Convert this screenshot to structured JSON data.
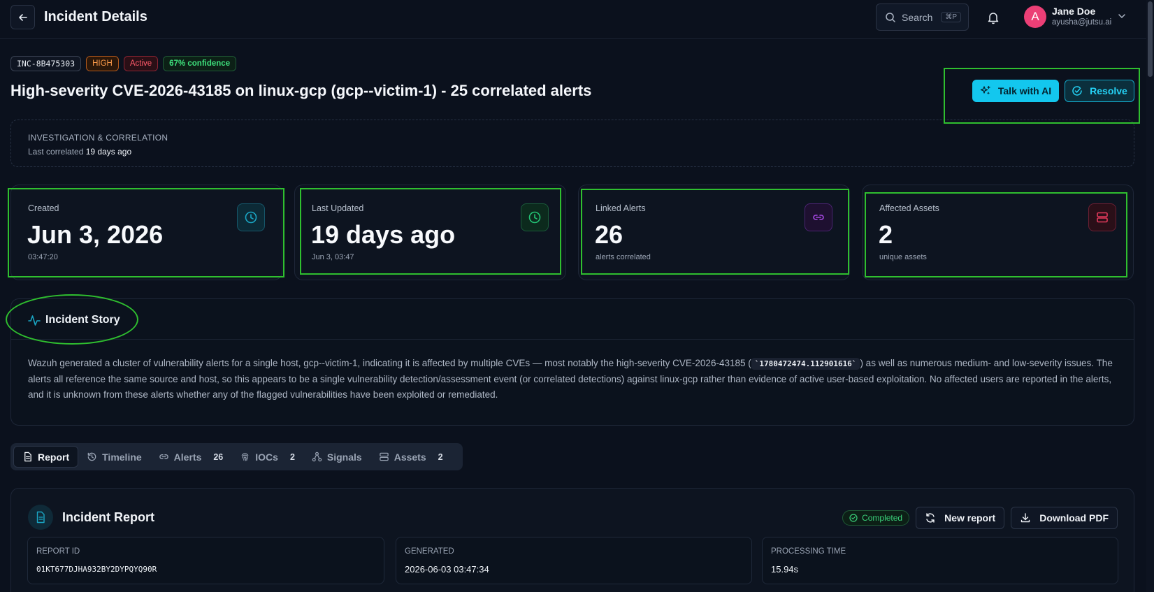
{
  "header": {
    "title": "Incident Details",
    "search_label": "Search",
    "search_shortcut": "⌘P",
    "user": {
      "initial": "A",
      "name": "Jane Doe",
      "email": "ayusha@jutsu.ai"
    }
  },
  "incident": {
    "id": "INC-8B475303",
    "severity": "HIGH",
    "status": "Active",
    "confidence": "67% confidence",
    "title": "High-severity CVE-2026-43185 on linux-gcp (gcp--victim-1) - 25 correlated alerts",
    "actions": {
      "talk_ai": "Talk with AI",
      "resolve": "Resolve"
    }
  },
  "investigation": {
    "heading": "INVESTIGATION & CORRELATION",
    "last_correlated_label": "Last correlated",
    "last_correlated_value": "19 days ago"
  },
  "stats": [
    {
      "label": "Created",
      "value": "Jun 3, 2026",
      "sub": "03:47:20",
      "icon": "clock-icon",
      "color": "#1aa6c4"
    },
    {
      "label": "Last Updated",
      "value": "19 days ago",
      "sub": "Jun 3, 03:47",
      "icon": "clock-icon",
      "color": "#23c274"
    },
    {
      "label": "Linked Alerts",
      "value": "26",
      "sub": "alerts correlated",
      "icon": "link-icon",
      "color": "#a447e0"
    },
    {
      "label": "Affected Assets",
      "value": "2",
      "sub": "unique assets",
      "icon": "server-icon",
      "color": "#e43a5c"
    }
  ],
  "story": {
    "title": "Incident Story",
    "text_before": "Wazuh generated a cluster of vulnerability alerts for a single host, gcp--victim-1, indicating it is affected by multiple CVEs — most notably the high-severity CVE-2026-43185 (",
    "code": "`1780472474.112901616`",
    "text_after": ") as well as numerous medium- and low-severity issues. The alerts all reference the same source and host, so this appears to be a single vulnerability detection/assessment event (or correlated detections) against linux-gcp rather than evidence of active user-based exploitation. No affected users are reported in the alerts, and it is unknown from these alerts whether any of the flagged vulnerabilities have been exploited or remediated."
  },
  "tabs": [
    {
      "label": "Report",
      "count": ""
    },
    {
      "label": "Timeline",
      "count": ""
    },
    {
      "label": "Alerts",
      "count": "26"
    },
    {
      "label": "IOCs",
      "count": "2"
    },
    {
      "label": "Signals",
      "count": ""
    },
    {
      "label": "Assets",
      "count": "2"
    }
  ],
  "report": {
    "title": "Incident Report",
    "status": "Completed",
    "new_report": "New report",
    "download_pdf": "Download PDF",
    "meta": [
      {
        "label": "REPORT ID",
        "value": "01KT677DJHA932BY2DYPQYQ90R"
      },
      {
        "label": "GENERATED",
        "value": "2026-06-03 03:47:34"
      },
      {
        "label": "PROCESSING TIME",
        "value": "15.94s"
      }
    ]
  }
}
